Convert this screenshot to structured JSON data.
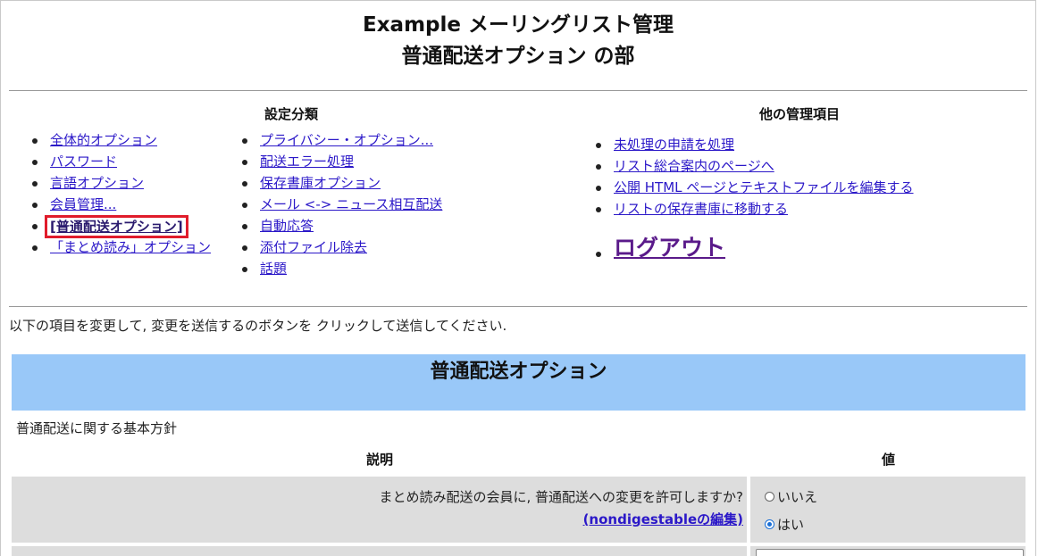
{
  "header": {
    "title_line1": "Example メーリングリスト管理",
    "title_line2": "普通配送オプション の部"
  },
  "categories": {
    "heading": "設定分類",
    "left_items": [
      {
        "label": "全体的オプション"
      },
      {
        "label": "パスワード"
      },
      {
        "label": "言語オプション"
      },
      {
        "label": "会員管理..."
      },
      {
        "label": "[普通配送オプション]",
        "current": true
      },
      {
        "label": "「まとめ読み」オプション"
      }
    ],
    "right_items": [
      {
        "label": "プライバシー・オプション..."
      },
      {
        "label": "配送エラー処理"
      },
      {
        "label": "保存書庫オプション"
      },
      {
        "label": "メール <-> ニュース相互配送"
      },
      {
        "label": "自動応答"
      },
      {
        "label": "添付ファイル除去"
      },
      {
        "label": "話題"
      }
    ]
  },
  "other_admin": {
    "heading": "他の管理項目",
    "items": [
      {
        "label": "未処理の申請を処理"
      },
      {
        "label": "リスト総合案内のページへ"
      },
      {
        "label": "公開 HTML ページとテキストファイルを編集する"
      },
      {
        "label": "リストの保存書庫に移動する"
      }
    ],
    "logout": "ログアウト"
  },
  "instruction": "以下の項目を変更して, 変更を送信するのボタンを クリックして送信してください.",
  "section": {
    "title": "普通配送オプション",
    "subtitle": "普通配送に関する基本方針",
    "col_desc": "説明",
    "col_value": "値"
  },
  "settings": [
    {
      "question": "まとめ読み配送の会員に, 普通配送への変更を許可しますか?",
      "edit_link": "(nondigestableの編集)",
      "options": [
        {
          "label": "いいえ",
          "checked": false
        },
        {
          "label": "はい",
          "checked": true
        }
      ]
    }
  ],
  "colors": {
    "link": "#2b18c8",
    "section_bar": "#99c8f8",
    "row_bg": "#dddddd",
    "current_border": "#e01c2b",
    "logout": "#5a1a8a"
  }
}
